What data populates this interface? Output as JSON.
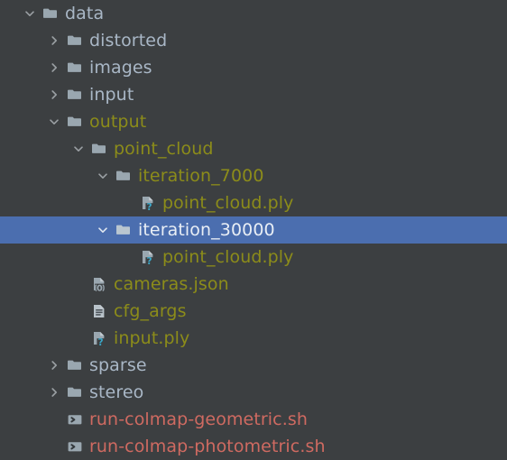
{
  "panel": {
    "name": "project-file-tree",
    "background_color": "#3c3f41",
    "selection_color": "#4b6eaf"
  },
  "colors": {
    "default_text": "#a9b7c6",
    "tracked_text": "#8c8c1a",
    "script_text": "#cf6a61",
    "selected_text": "#e8eef5",
    "folder_icon": "#9aa7b0"
  },
  "tree": {
    "rows": [
      {
        "label": "data",
        "depth": 0,
        "icon": "folder-icon",
        "toggle": "chevron-down-icon",
        "color": "default",
        "selected": false
      },
      {
        "label": "distorted",
        "depth": 1,
        "icon": "folder-icon",
        "toggle": "chevron-right-icon",
        "color": "default",
        "selected": false
      },
      {
        "label": "images",
        "depth": 1,
        "icon": "folder-icon",
        "toggle": "chevron-right-icon",
        "color": "default",
        "selected": false
      },
      {
        "label": "input",
        "depth": 1,
        "icon": "folder-icon",
        "toggle": "chevron-right-icon",
        "color": "default",
        "selected": false
      },
      {
        "label": "output",
        "depth": 1,
        "icon": "folder-icon",
        "toggle": "chevron-down-icon",
        "color": "tracked",
        "selected": false
      },
      {
        "label": "point_cloud",
        "depth": 2,
        "icon": "folder-icon",
        "toggle": "chevron-down-icon",
        "color": "tracked",
        "selected": false
      },
      {
        "label": "iteration_7000",
        "depth": 3,
        "icon": "folder-icon",
        "toggle": "chevron-down-icon",
        "color": "tracked",
        "selected": false
      },
      {
        "label": "point_cloud.ply",
        "depth": 4,
        "icon": "unknown-file-icon",
        "toggle": "none",
        "color": "tracked",
        "selected": false
      },
      {
        "label": "iteration_30000",
        "depth": 3,
        "icon": "folder-icon",
        "toggle": "chevron-down-icon",
        "color": "selected",
        "selected": true
      },
      {
        "label": "point_cloud.ply",
        "depth": 4,
        "icon": "unknown-file-icon",
        "toggle": "none",
        "color": "tracked",
        "selected": false
      },
      {
        "label": "cameras.json",
        "depth": 2,
        "icon": "json-file-icon",
        "toggle": "none",
        "color": "tracked",
        "selected": false
      },
      {
        "label": "cfg_args",
        "depth": 2,
        "icon": "text-file-icon",
        "toggle": "none",
        "color": "tracked",
        "selected": false
      },
      {
        "label": "input.ply",
        "depth": 2,
        "icon": "unknown-file-icon",
        "toggle": "none",
        "color": "tracked",
        "selected": false
      },
      {
        "label": "sparse",
        "depth": 1,
        "icon": "folder-icon",
        "toggle": "chevron-right-icon",
        "color": "default",
        "selected": false
      },
      {
        "label": "stereo",
        "depth": 1,
        "icon": "folder-icon",
        "toggle": "chevron-right-icon",
        "color": "default",
        "selected": false
      },
      {
        "label": "run-colmap-geometric.sh",
        "depth": 1,
        "icon": "shell-script-icon",
        "toggle": "none",
        "color": "script",
        "selected": false
      },
      {
        "label": "run-colmap-photometric.sh",
        "depth": 1,
        "icon": "shell-script-icon",
        "toggle": "none",
        "color": "script",
        "selected": false
      }
    ]
  }
}
